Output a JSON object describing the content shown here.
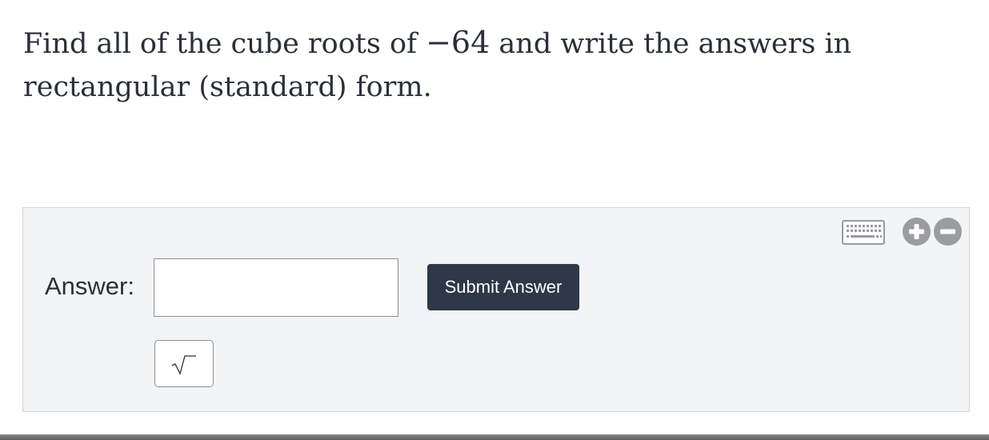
{
  "question": {
    "part1": "Find all of the cube roots of ",
    "number": "−64",
    "part2": " and write the answers in rectangular (standard) form."
  },
  "answer": {
    "label": "Answer:",
    "input_value": "",
    "submit_label": "Submit Answer"
  },
  "toolbar": {
    "icons": [
      "keyboard-icon",
      "plus-icon",
      "minus-icon"
    ],
    "sqrt_button_icon": "sqrt-icon"
  },
  "colors": {
    "text": "#2b2f38",
    "button_bg": "#2d3848",
    "panel_bg": "#f3f4f5",
    "icon_gray": "#9a9ca0"
  }
}
